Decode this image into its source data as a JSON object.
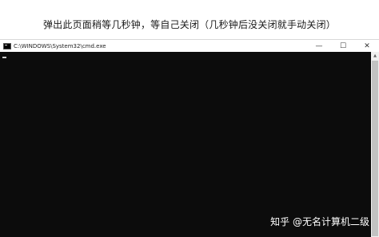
{
  "caption": "弹出此页面稍等几秒钟，等自己关闭（几秒钟后没关闭就手动关闭）",
  "window": {
    "title": "C:\\WINDOWS\\System32\\cmd.exe",
    "controls": {
      "minimize": "—",
      "maximize": "☐",
      "close": "✕"
    }
  },
  "watermark": "知乎 @无名计算机二级",
  "icons": {
    "app": "cmd-icon",
    "scroll_up": "up-arrow-icon"
  }
}
